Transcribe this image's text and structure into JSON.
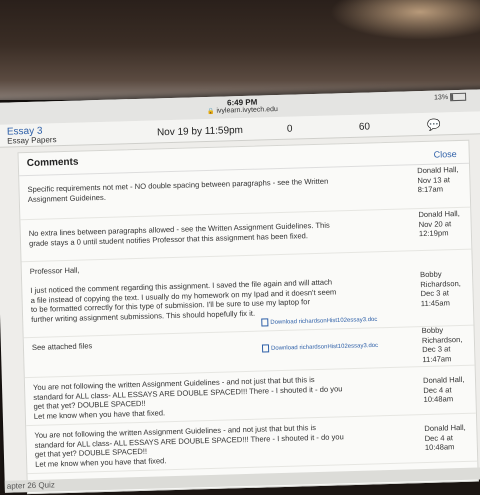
{
  "status_bar": {
    "time": "6:49 PM",
    "url": "ivylearn.ivytech.edu",
    "battery": "13%"
  },
  "assignment": {
    "title": "Essay 3",
    "subtitle": "Essay Papers",
    "due": "Nov 19 by 11:59pm",
    "score": "0",
    "out_of": "60"
  },
  "comments_panel": {
    "title": "Comments",
    "close_label": "Close",
    "items": [
      {
        "text": "Specific requirements not met - NO double spacing between paragraphs - see the Written\nAssignment Guideines.",
        "meta": "Donald\nHall, Nov\n13 at\n8:17am"
      },
      {
        "text": "No extra lines between paragraphs allowed - see the Written Assignment Guidelines.  This\ngrade stays a 0 until student notifies Professor that this assignment has been fixed.",
        "meta": "Donald\nHall, Nov\n20 at\n12:19pm"
      },
      {
        "text": "Professor Hall,\n\nI just noticed the comment regarding this assignment.  I saved the file again and will attach\na file instead of copying the text.  I usually do my homework on my Ipad and it doesn't seem\nto be formatted correctly for this type of submission.  I'll be sure to use my laptop for\nfurther writing assignment submissions.  This should hopefully fix it.",
        "meta": "Bobby\nRichardson,\nDec 3 at\n11:45am",
        "attachment": "Download richardsonHist102essay3.doc"
      },
      {
        "text": "See attached files",
        "meta": "Bobby\nRichardson,\nDec 3 at\n11:47am",
        "attachment": "Download richardsonHist102essay3.doc"
      },
      {
        "text": "You are not following the written Assignment Guidelines - and not just that but this is\nstandard for ALL class- ALL ESSAYS ARE DOUBLE SPACED!!! There - I shouted it - do you\nget that yet? DOUBLE SPACED!!\nLet me know when you have that fixed.",
        "meta": "Donald\nHall, Dec 4\nat 10:48am"
      },
      {
        "text": "You are not following the written Assignment Guidelines - and not just that but this is\nstandard for ALL class- ALL ESSAYS ARE DOUBLE SPACED!!! There - I shouted it - do you\nget that yet? DOUBLE SPACED!!\nLet me know when you have that fixed.",
        "meta": "Donald\nHall, Dec 4\nat 10:48am"
      }
    ]
  },
  "bottom": {
    "partial_label": "apter 26 Quiz"
  }
}
